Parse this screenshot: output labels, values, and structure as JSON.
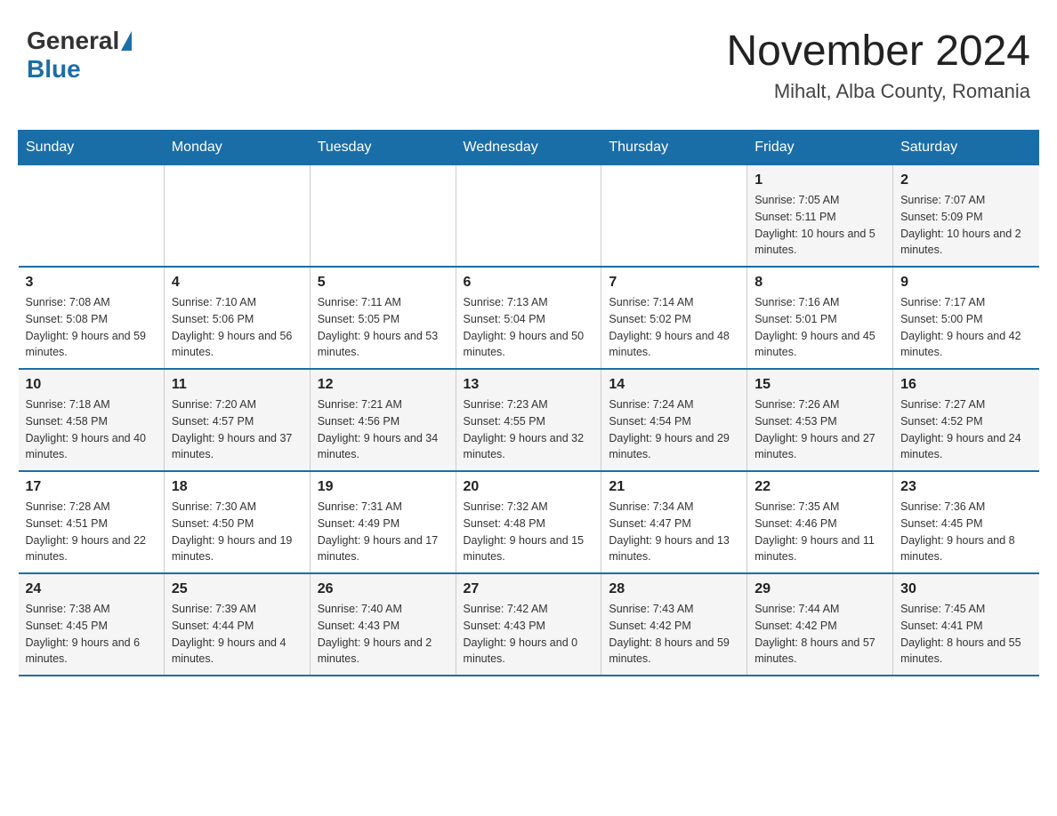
{
  "header": {
    "logo_general": "General",
    "logo_blue": "Blue",
    "month_title": "November 2024",
    "location": "Mihalt, Alba County, Romania"
  },
  "days_of_week": [
    "Sunday",
    "Monday",
    "Tuesday",
    "Wednesday",
    "Thursday",
    "Friday",
    "Saturday"
  ],
  "weeks": [
    [
      {
        "day": "",
        "sunrise": "",
        "sunset": "",
        "daylight": ""
      },
      {
        "day": "",
        "sunrise": "",
        "sunset": "",
        "daylight": ""
      },
      {
        "day": "",
        "sunrise": "",
        "sunset": "",
        "daylight": ""
      },
      {
        "day": "",
        "sunrise": "",
        "sunset": "",
        "daylight": ""
      },
      {
        "day": "",
        "sunrise": "",
        "sunset": "",
        "daylight": ""
      },
      {
        "day": "1",
        "sunrise": "Sunrise: 7:05 AM",
        "sunset": "Sunset: 5:11 PM",
        "daylight": "Daylight: 10 hours and 5 minutes."
      },
      {
        "day": "2",
        "sunrise": "Sunrise: 7:07 AM",
        "sunset": "Sunset: 5:09 PM",
        "daylight": "Daylight: 10 hours and 2 minutes."
      }
    ],
    [
      {
        "day": "3",
        "sunrise": "Sunrise: 7:08 AM",
        "sunset": "Sunset: 5:08 PM",
        "daylight": "Daylight: 9 hours and 59 minutes."
      },
      {
        "day": "4",
        "sunrise": "Sunrise: 7:10 AM",
        "sunset": "Sunset: 5:06 PM",
        "daylight": "Daylight: 9 hours and 56 minutes."
      },
      {
        "day": "5",
        "sunrise": "Sunrise: 7:11 AM",
        "sunset": "Sunset: 5:05 PM",
        "daylight": "Daylight: 9 hours and 53 minutes."
      },
      {
        "day": "6",
        "sunrise": "Sunrise: 7:13 AM",
        "sunset": "Sunset: 5:04 PM",
        "daylight": "Daylight: 9 hours and 50 minutes."
      },
      {
        "day": "7",
        "sunrise": "Sunrise: 7:14 AM",
        "sunset": "Sunset: 5:02 PM",
        "daylight": "Daylight: 9 hours and 48 minutes."
      },
      {
        "day": "8",
        "sunrise": "Sunrise: 7:16 AM",
        "sunset": "Sunset: 5:01 PM",
        "daylight": "Daylight: 9 hours and 45 minutes."
      },
      {
        "day": "9",
        "sunrise": "Sunrise: 7:17 AM",
        "sunset": "Sunset: 5:00 PM",
        "daylight": "Daylight: 9 hours and 42 minutes."
      }
    ],
    [
      {
        "day": "10",
        "sunrise": "Sunrise: 7:18 AM",
        "sunset": "Sunset: 4:58 PM",
        "daylight": "Daylight: 9 hours and 40 minutes."
      },
      {
        "day": "11",
        "sunrise": "Sunrise: 7:20 AM",
        "sunset": "Sunset: 4:57 PM",
        "daylight": "Daylight: 9 hours and 37 minutes."
      },
      {
        "day": "12",
        "sunrise": "Sunrise: 7:21 AM",
        "sunset": "Sunset: 4:56 PM",
        "daylight": "Daylight: 9 hours and 34 minutes."
      },
      {
        "day": "13",
        "sunrise": "Sunrise: 7:23 AM",
        "sunset": "Sunset: 4:55 PM",
        "daylight": "Daylight: 9 hours and 32 minutes."
      },
      {
        "day": "14",
        "sunrise": "Sunrise: 7:24 AM",
        "sunset": "Sunset: 4:54 PM",
        "daylight": "Daylight: 9 hours and 29 minutes."
      },
      {
        "day": "15",
        "sunrise": "Sunrise: 7:26 AM",
        "sunset": "Sunset: 4:53 PM",
        "daylight": "Daylight: 9 hours and 27 minutes."
      },
      {
        "day": "16",
        "sunrise": "Sunrise: 7:27 AM",
        "sunset": "Sunset: 4:52 PM",
        "daylight": "Daylight: 9 hours and 24 minutes."
      }
    ],
    [
      {
        "day": "17",
        "sunrise": "Sunrise: 7:28 AM",
        "sunset": "Sunset: 4:51 PM",
        "daylight": "Daylight: 9 hours and 22 minutes."
      },
      {
        "day": "18",
        "sunrise": "Sunrise: 7:30 AM",
        "sunset": "Sunset: 4:50 PM",
        "daylight": "Daylight: 9 hours and 19 minutes."
      },
      {
        "day": "19",
        "sunrise": "Sunrise: 7:31 AM",
        "sunset": "Sunset: 4:49 PM",
        "daylight": "Daylight: 9 hours and 17 minutes."
      },
      {
        "day": "20",
        "sunrise": "Sunrise: 7:32 AM",
        "sunset": "Sunset: 4:48 PM",
        "daylight": "Daylight: 9 hours and 15 minutes."
      },
      {
        "day": "21",
        "sunrise": "Sunrise: 7:34 AM",
        "sunset": "Sunset: 4:47 PM",
        "daylight": "Daylight: 9 hours and 13 minutes."
      },
      {
        "day": "22",
        "sunrise": "Sunrise: 7:35 AM",
        "sunset": "Sunset: 4:46 PM",
        "daylight": "Daylight: 9 hours and 11 minutes."
      },
      {
        "day": "23",
        "sunrise": "Sunrise: 7:36 AM",
        "sunset": "Sunset: 4:45 PM",
        "daylight": "Daylight: 9 hours and 8 minutes."
      }
    ],
    [
      {
        "day": "24",
        "sunrise": "Sunrise: 7:38 AM",
        "sunset": "Sunset: 4:45 PM",
        "daylight": "Daylight: 9 hours and 6 minutes."
      },
      {
        "day": "25",
        "sunrise": "Sunrise: 7:39 AM",
        "sunset": "Sunset: 4:44 PM",
        "daylight": "Daylight: 9 hours and 4 minutes."
      },
      {
        "day": "26",
        "sunrise": "Sunrise: 7:40 AM",
        "sunset": "Sunset: 4:43 PM",
        "daylight": "Daylight: 9 hours and 2 minutes."
      },
      {
        "day": "27",
        "sunrise": "Sunrise: 7:42 AM",
        "sunset": "Sunset: 4:43 PM",
        "daylight": "Daylight: 9 hours and 0 minutes."
      },
      {
        "day": "28",
        "sunrise": "Sunrise: 7:43 AM",
        "sunset": "Sunset: 4:42 PM",
        "daylight": "Daylight: 8 hours and 59 minutes."
      },
      {
        "day": "29",
        "sunrise": "Sunrise: 7:44 AM",
        "sunset": "Sunset: 4:42 PM",
        "daylight": "Daylight: 8 hours and 57 minutes."
      },
      {
        "day": "30",
        "sunrise": "Sunrise: 7:45 AM",
        "sunset": "Sunset: 4:41 PM",
        "daylight": "Daylight: 8 hours and 55 minutes."
      }
    ]
  ]
}
